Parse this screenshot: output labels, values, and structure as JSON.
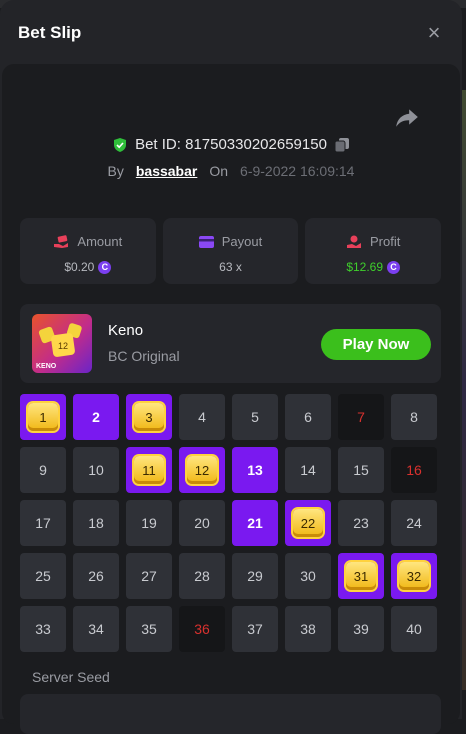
{
  "modal": {
    "title": "Bet Slip",
    "close_glyph": "×"
  },
  "bet": {
    "id_label": "Bet ID: 81750330202659150",
    "by_label": "By",
    "user": "bassabar",
    "on_label": "On",
    "date": "6-9-2022 16:09:14"
  },
  "stats": {
    "amount": {
      "label": "Amount",
      "value": "$0.20",
      "icon": "money-hand-icon"
    },
    "payout": {
      "label": "Payout",
      "value": "63 x",
      "icon": "card-icon"
    },
    "profit": {
      "label": "Profit",
      "value": "$12.69",
      "icon": "hand-coin-icon"
    }
  },
  "coin_glyph": "C",
  "game": {
    "name": "Keno",
    "subtitle": "BC Original",
    "play_label": "Play Now",
    "thumb_text": "KENO",
    "thumb_tile_number": "12"
  },
  "keno": {
    "cells": [
      {
        "n": "1",
        "state": "gem"
      },
      {
        "n": "2",
        "state": "sel"
      },
      {
        "n": "3",
        "state": "gem"
      },
      {
        "n": "4",
        "state": "none"
      },
      {
        "n": "5",
        "state": "none"
      },
      {
        "n": "6",
        "state": "none"
      },
      {
        "n": "7",
        "state": "miss"
      },
      {
        "n": "8",
        "state": "none"
      },
      {
        "n": "9",
        "state": "none"
      },
      {
        "n": "10",
        "state": "none"
      },
      {
        "n": "11",
        "state": "gem"
      },
      {
        "n": "12",
        "state": "gem"
      },
      {
        "n": "13",
        "state": "sel"
      },
      {
        "n": "14",
        "state": "none"
      },
      {
        "n": "15",
        "state": "none"
      },
      {
        "n": "16",
        "state": "miss"
      },
      {
        "n": "17",
        "state": "none"
      },
      {
        "n": "18",
        "state": "none"
      },
      {
        "n": "19",
        "state": "none"
      },
      {
        "n": "20",
        "state": "none"
      },
      {
        "n": "21",
        "state": "sel"
      },
      {
        "n": "22",
        "state": "gem"
      },
      {
        "n": "23",
        "state": "none"
      },
      {
        "n": "24",
        "state": "none"
      },
      {
        "n": "25",
        "state": "none"
      },
      {
        "n": "26",
        "state": "none"
      },
      {
        "n": "27",
        "state": "none"
      },
      {
        "n": "28",
        "state": "none"
      },
      {
        "n": "29",
        "state": "none"
      },
      {
        "n": "30",
        "state": "none"
      },
      {
        "n": "31",
        "state": "gem"
      },
      {
        "n": "32",
        "state": "gem"
      },
      {
        "n": "33",
        "state": "none"
      },
      {
        "n": "34",
        "state": "none"
      },
      {
        "n": "35",
        "state": "none"
      },
      {
        "n": "36",
        "state": "miss"
      },
      {
        "n": "37",
        "state": "none"
      },
      {
        "n": "38",
        "state": "none"
      },
      {
        "n": "39",
        "state": "none"
      },
      {
        "n": "40",
        "state": "none"
      }
    ]
  },
  "seed": {
    "label": "Server Seed"
  },
  "colors": {
    "accent_purple": "#7a19f0",
    "play_green": "#3bbf1c",
    "profit_green": "#3fcf2c",
    "miss_red": "#d8312e"
  }
}
